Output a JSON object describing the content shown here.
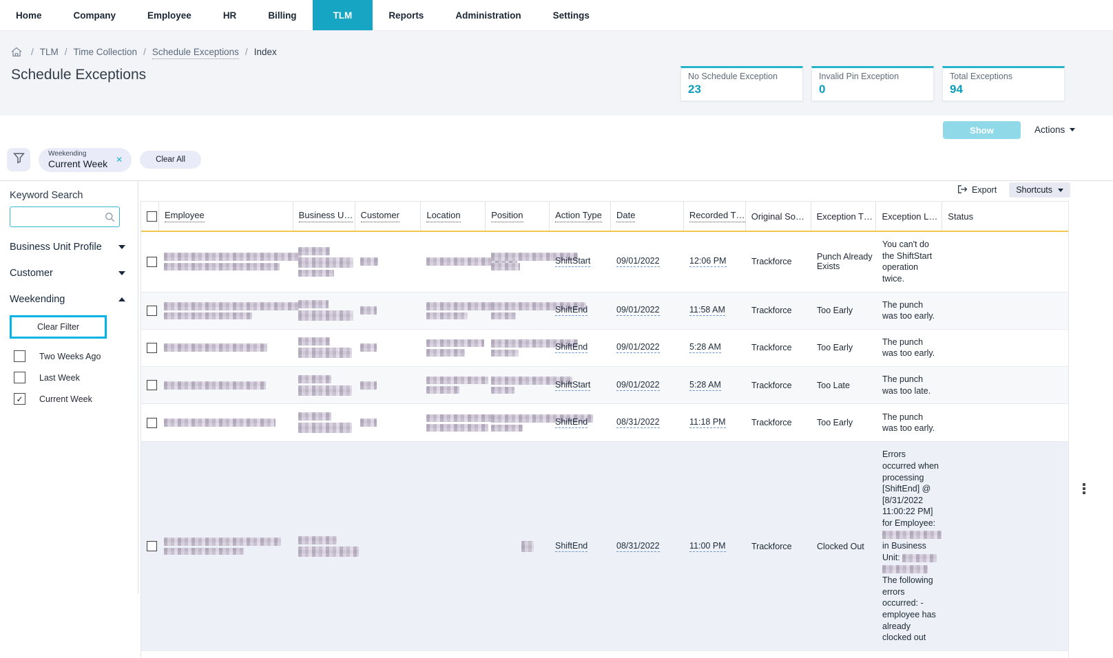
{
  "nav": {
    "items": [
      {
        "label": "Home"
      },
      {
        "label": "Company"
      },
      {
        "label": "Employee"
      },
      {
        "label": "HR"
      },
      {
        "label": "Billing"
      },
      {
        "label": "TLM",
        "active": true
      },
      {
        "label": "Reports"
      },
      {
        "label": "Administration"
      },
      {
        "label": "Settings"
      }
    ]
  },
  "breadcrumb": {
    "items": [
      {
        "label": "TLM"
      },
      {
        "label": "Time Collection"
      },
      {
        "label": "Schedule Exceptions",
        "underline": true
      },
      {
        "label": "Index",
        "current": true
      }
    ]
  },
  "page": {
    "title": "Schedule Exceptions"
  },
  "summary_cards": [
    {
      "label": "No Schedule Exception",
      "value": "23"
    },
    {
      "label": "Invalid Pin Exception",
      "value": "0"
    },
    {
      "label": "Total Exceptions",
      "value": "94"
    }
  ],
  "toolbar": {
    "show": "Show",
    "actions": "Actions"
  },
  "filter_bar": {
    "chip_category": "Weekending",
    "chip_value": "Current Week",
    "clear_all": "Clear All"
  },
  "sidebar": {
    "keyword_label": "Keyword Search",
    "search_value": "",
    "sections": [
      {
        "label": "Business Unit Profile",
        "expanded": false
      },
      {
        "label": "Customer",
        "expanded": false
      },
      {
        "label": "Weekending",
        "expanded": true
      }
    ],
    "clear_filter": "Clear Filter",
    "weekending_options": [
      {
        "label": "Two Weeks Ago",
        "checked": false
      },
      {
        "label": "Last Week",
        "checked": false
      },
      {
        "label": "Current Week",
        "checked": true
      }
    ]
  },
  "icons": {
    "close": "✕",
    "check": "✓"
  },
  "table": {
    "export": "Export",
    "shortcuts": "Shortcuts",
    "columns": [
      {
        "label": "Employee",
        "sortable": true
      },
      {
        "label": "Business U…",
        "sortable": true
      },
      {
        "label": "Customer",
        "sortable": true
      },
      {
        "label": "Location",
        "sortable": true
      },
      {
        "label": "Position",
        "sortable": true
      },
      {
        "label": "Action Type",
        "sortable": true
      },
      {
        "label": "Date",
        "sortable": true
      },
      {
        "label": "Recorded T…",
        "sortable": true
      },
      {
        "label": "Original So…",
        "sortable": false
      },
      {
        "label": "Exception T…",
        "sortable": false
      },
      {
        "label": "Exception L…",
        "sortable": false
      },
      {
        "label": "Status",
        "sortable": false
      }
    ],
    "rows": [
      {
        "action": "ShiftStart",
        "date": "09/01/2022",
        "time": "12:06 PM",
        "source": "Trackforce",
        "exception_type": "Punch Already Exists",
        "message": [
          {
            "t": "You can't do the ShiftStart operation twice."
          }
        ],
        "redactions": {
          "employee": [
            [
              200,
              12
            ],
            [
              168,
              11
            ]
          ],
          "business_unit": [
            [
              46,
              12
            ],
            [
              80,
              15
            ],
            [
              52,
              10
            ]
          ],
          "customer": [
            [
              26,
              12
            ]
          ],
          "location": [
            [
              132,
              12
            ]
          ],
          "position": [
            [
              126,
              12
            ],
            [
              42,
              11
            ]
          ]
        }
      },
      {
        "action": "ShiftEnd",
        "date": "09/01/2022",
        "time": "11:58 AM",
        "source": "Trackforce",
        "exception_type": "Too Early",
        "message": [
          {
            "t": "The punch was too early."
          }
        ],
        "redactions": {
          "employee": [
            [
              196,
              12
            ],
            [
              128,
              10
            ]
          ],
          "business_unit": [
            [
              44,
              12
            ],
            [
              80,
              15
            ]
          ],
          "customer": [
            [
              24,
              12
            ]
          ],
          "location": [
            [
              148,
              12
            ],
            [
              60,
              10
            ]
          ],
          "position": [
            [
              138,
              12
            ],
            [
              36,
              10
            ]
          ]
        }
      },
      {
        "action": "ShiftEnd",
        "date": "09/01/2022",
        "time": "5:28 AM",
        "source": "Trackforce",
        "exception_type": "Too Early",
        "message": [
          {
            "t": "The punch was too early."
          }
        ],
        "redactions": {
          "employee": [
            [
              150,
              12
            ]
          ],
          "business_unit": [
            [
              46,
              12
            ],
            [
              78,
              15
            ]
          ],
          "customer": [
            [
              24,
              12
            ]
          ],
          "location": [
            [
              84,
              11
            ],
            [
              56,
              11
            ]
          ],
          "position": [
            [
              126,
              12
            ],
            [
              40,
              10
            ]
          ]
        }
      },
      {
        "action": "ShiftStart",
        "date": "09/01/2022",
        "time": "5:28 AM",
        "source": "Trackforce",
        "exception_type": "Too Late",
        "message": [
          {
            "t": "The punch was too late."
          }
        ],
        "redactions": {
          "employee": [
            [
              148,
              12
            ]
          ],
          "business_unit": [
            [
              48,
              12
            ],
            [
              78,
              15
            ]
          ],
          "customer": [
            [
              24,
              12
            ]
          ],
          "location": [
            [
              90,
              11
            ],
            [
              48,
              11
            ]
          ],
          "position": [
            [
              118,
              12
            ],
            [
              34,
              10
            ]
          ]
        }
      },
      {
        "action": "ShiftEnd",
        "date": "08/31/2022",
        "time": "11:18 PM",
        "source": "Trackforce",
        "exception_type": "Too Early",
        "message": [
          {
            "t": "The punch was too early."
          }
        ],
        "redactions": {
          "employee": [
            [
              162,
              12
            ]
          ],
          "business_unit": [
            [
              48,
              12
            ],
            [
              78,
              15
            ]
          ],
          "customer": [
            [
              24,
              12
            ]
          ],
          "location": [
            [
              116,
              11
            ],
            [
              90,
              11
            ]
          ],
          "position": [
            [
              148,
              12
            ],
            [
              46,
              10
            ]
          ]
        }
      },
      {
        "action": "ShiftEnd",
        "date": "08/31/2022",
        "time": "11:00 PM",
        "source": "Trackforce",
        "exception_type": "Clocked Out",
        "message": [
          {
            "t": "Errors occurred when processing [ShiftEnd] @ [8/31/2022 11:00:22 PM] for Employee: "
          },
          {
            "r": [
              86,
              12
            ]
          },
          {
            "t": " in Business Unit: "
          },
          {
            "r": [
              50,
              12
            ]
          },
          {
            "t": " "
          },
          {
            "r": [
              66,
              12
            ]
          },
          {
            "t": " The following errors occurred: - employee has already clocked out"
          }
        ],
        "redactions": {
          "employee": [
            [
              170,
              12
            ],
            [
              116,
              10
            ]
          ],
          "business_unit": [
            [
              56,
              12
            ],
            [
              88,
              15
            ]
          ],
          "customer": [],
          "location": [],
          "position": [
            [
              18,
              16,
              44
            ]
          ]
        }
      }
    ]
  }
}
